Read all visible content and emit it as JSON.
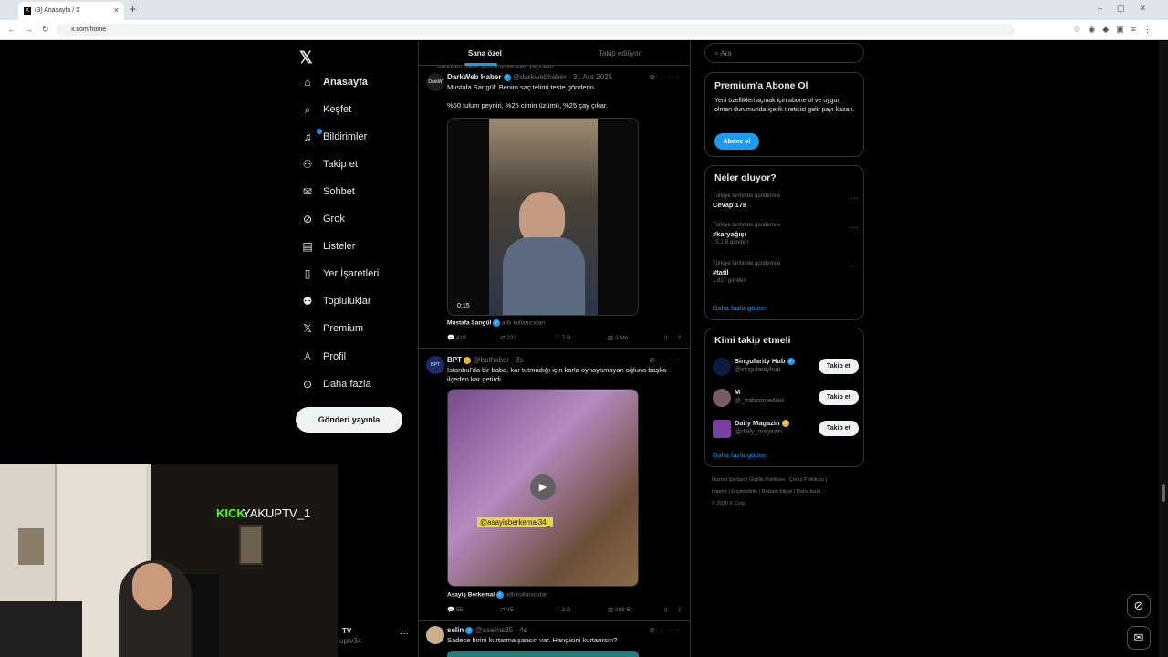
{
  "browser": {
    "tab_title": "(3) Anasayfa / X",
    "url": "x.com/home"
  },
  "nav": {
    "items": [
      {
        "label": "Anasayfa",
        "icon": "home-icon"
      },
      {
        "label": "Keşfet",
        "icon": "search-icon"
      },
      {
        "label": "Bildirimler",
        "icon": "bell-icon"
      },
      {
        "label": "Takip et",
        "icon": "follow-icon"
      },
      {
        "label": "Sohbet",
        "icon": "mail-icon"
      },
      {
        "label": "Grok",
        "icon": "grok-icon"
      },
      {
        "label": "Listeler",
        "icon": "list-icon"
      },
      {
        "label": "Yer İşaretleri",
        "icon": "bookmark-icon"
      },
      {
        "label": "Topluluklar",
        "icon": "communities-icon"
      },
      {
        "label": "Premium",
        "icon": "x-icon"
      },
      {
        "label": "Profil",
        "icon": "profile-icon"
      },
      {
        "label": "Daha fazla",
        "icon": "more-icon"
      }
    ],
    "post_button": "Gönderi yayınla",
    "account_name": "TV",
    "account_handle": "uptv34"
  },
  "overlay": {
    "kick_logo": "KICK",
    "channel": "YAKUPTV_1"
  },
  "timeline": {
    "tab_active": "Sana özel",
    "tab_inactive": "Takip ediliyor",
    "tweets": [
      {
        "repost_hint": "DarkWeb Haber gönderiyi yeniden yayınladı",
        "name": "DarkWeb Haber",
        "handle": "@darkwebhaber · 31 Ara 2025",
        "text1": "Mustafa Sarıgül: Benim saç telimi teste gönderin.",
        "text2": "%50 tulum peyniri, %25 cimin üzümü, %25 çay çıkar.",
        "duration": "0:15",
        "credit_name": "Mustafa Sarıgül",
        "credit_suffix": "adlı kullanıcıdan",
        "replies": "419",
        "reposts": "233",
        "likes": "7 B",
        "views": "3 Mn"
      },
      {
        "name": "BPT",
        "handle": "@bpthaber · 3s",
        "text1": "İstanbul'da bir baba, kar tutmadığı için karla oynayamayan oğluna başka ilçeden kar getirdi.",
        "watermark": "@asayisberkemal34_",
        "credit_name": "Asayiş Berkemal",
        "credit_suffix": "adlı kullanıcıdan",
        "replies": "55",
        "reposts": "45",
        "likes": "2 B",
        "views": "208 B"
      },
      {
        "name": "selin",
        "handle": "@sselins35 · 4s",
        "text1": "Sadece birini kurtarma şansın var. Hangisini kurtarırsın?"
      }
    ]
  },
  "sidebar": {
    "search_placeholder": "Ara",
    "premium": {
      "title": "Premium'a Abone Ol",
      "desc": "Yeni özellikleri açmak için abone ol ve uygun olman durumunda içerik üreticisi gelir payı kazan.",
      "button": "Abone ol"
    },
    "trends": {
      "title": "Neler oluyor?",
      "items": [
        {
          "context": "Türkiye tarihinde gündemde",
          "name": "Cevap 178",
          "count": ""
        },
        {
          "context": "Türkiye tarihinde gündemde",
          "name": "#karyağışı",
          "count": "15,1 B gönderi"
        },
        {
          "context": "Türkiye tarihinde gündemde",
          "name": "#tatil",
          "count": "1.817 gönderi"
        }
      ],
      "show_more": "Daha fazla göster"
    },
    "who_to_follow": {
      "title": "Kimi takip etmeli",
      "items": [
        {
          "name": "Singularity Hub",
          "handle": "@singularityhub",
          "button": "Takip et",
          "avatar_color": "#0d1b3e"
        },
        {
          "name": "M",
          "handle": "@_trabzonfedaisi",
          "button": "Takip et",
          "avatar_color": "#7a5a6a"
        },
        {
          "name": "Daily Magazin",
          "handle": "@daily_magazin",
          "button": "Takip et",
          "avatar_color": "#7b3fa0"
        }
      ],
      "show_more": "Daha fazla göster"
    },
    "footer": {
      "line1": "Hizmet Şartları  |  Gizlilik Politikası  |  Çerez Politikası  |",
      "line2": "Imprint  |  Erişilebilirlik  |  Reklam bilgisi  |  Daha fazla ···",
      "line3": "© 2026 X Corp."
    }
  },
  "colors": {
    "accent": "#1d9bf0",
    "kick_green": "#53fc18",
    "background": "#000000"
  }
}
